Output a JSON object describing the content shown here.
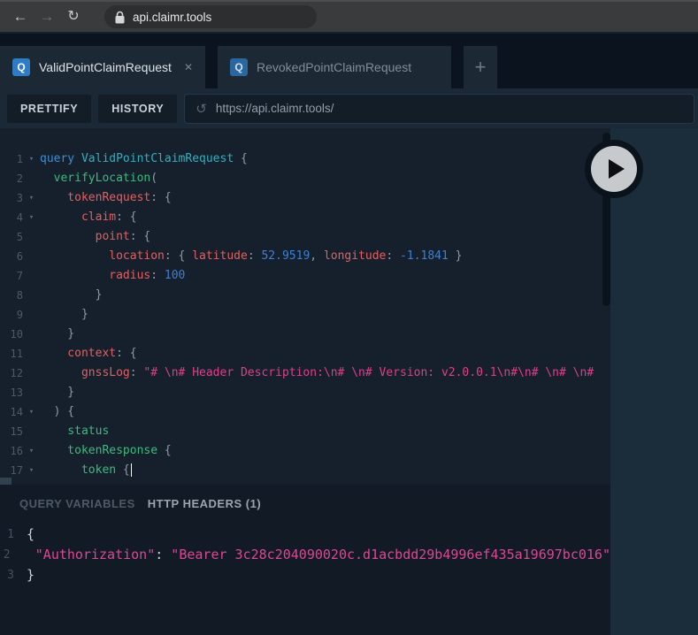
{
  "browser": {
    "back_icon": "←",
    "forward_icon": "→",
    "reload_icon": "↻",
    "url": "api.claimr.tools"
  },
  "tabs": [
    {
      "badge": "Q",
      "label": "ValidPointClaimRequest",
      "close_icon": "✕",
      "active": true
    },
    {
      "badge": "Q",
      "label": "RevokedPointClaimRequest",
      "active": false
    }
  ],
  "new_tab_label": "+",
  "toolbar": {
    "prettify_label": "PRETTIFY",
    "history_label": "HISTORY",
    "reload_icon": "↺",
    "endpoint_url": "https://api.claimr.tools/"
  },
  "editor": {
    "lines": [
      {
        "n": 1,
        "f": true,
        "t": [
          [
            "kw",
            "query"
          ],
          [
            "op",
            " ValidPointClaimRequest"
          ],
          [
            "pun",
            " {"
          ]
        ]
      },
      {
        "n": 2,
        "f": false,
        "t": [
          [
            "fld",
            "  verifyLocation"
          ],
          [
            "pun",
            "("
          ]
        ]
      },
      {
        "n": 3,
        "f": true,
        "t": [
          [
            "arg",
            "    tokenRequest"
          ],
          [
            "pun",
            ": {"
          ]
        ]
      },
      {
        "n": 4,
        "f": true,
        "t": [
          [
            "arg",
            "      claim"
          ],
          [
            "pun",
            ": {"
          ]
        ]
      },
      {
        "n": 5,
        "f": false,
        "t": [
          [
            "arg",
            "        point"
          ],
          [
            "pun",
            ": {"
          ]
        ]
      },
      {
        "n": 6,
        "f": false,
        "t": [
          [
            "arg",
            "          location"
          ],
          [
            "pun",
            ": { "
          ],
          [
            "arg",
            "latitude"
          ],
          [
            "pun",
            ": "
          ],
          [
            "num",
            "52.9519"
          ],
          [
            "pun",
            ", "
          ],
          [
            "arg",
            "longitude"
          ],
          [
            "pun",
            ": "
          ],
          [
            "num",
            "-1.1841"
          ],
          [
            "pun",
            " }"
          ]
        ]
      },
      {
        "n": 7,
        "f": false,
        "t": [
          [
            "arg",
            "          radius"
          ],
          [
            "pun",
            ": "
          ],
          [
            "num",
            "100"
          ]
        ]
      },
      {
        "n": 8,
        "f": false,
        "t": [
          [
            "pun",
            "        }"
          ]
        ]
      },
      {
        "n": 9,
        "f": false,
        "t": [
          [
            "pun",
            "      }"
          ]
        ]
      },
      {
        "n": 10,
        "f": false,
        "t": [
          [
            "pun",
            "    }"
          ]
        ]
      },
      {
        "n": 11,
        "f": false,
        "t": [
          [
            "arg",
            "    context"
          ],
          [
            "pun",
            ": {"
          ]
        ]
      },
      {
        "n": 12,
        "f": false,
        "t": [
          [
            "arg",
            "      gnssLog"
          ],
          [
            "pun",
            ": "
          ],
          [
            "str",
            "\"# \\n# Header Description:\\n# \\n# Version: v2.0.0.1\\n#\\n# \\n# \\n#"
          ]
        ]
      },
      {
        "n": 13,
        "f": false,
        "t": [
          [
            "pun",
            "    }"
          ]
        ]
      },
      {
        "n": 14,
        "f": true,
        "t": [
          [
            "pun",
            "  ) {"
          ]
        ]
      },
      {
        "n": 15,
        "f": false,
        "t": [
          [
            "fld",
            "    status"
          ]
        ]
      },
      {
        "n": 16,
        "f": true,
        "t": [
          [
            "fld",
            "    tokenResponse"
          ],
          [
            "pun",
            " {"
          ]
        ]
      },
      {
        "n": 17,
        "f": true,
        "t": [
          [
            "fld",
            "      token"
          ],
          [
            "pun",
            " {"
          ]
        ],
        "cursor": true
      }
    ]
  },
  "bottom": {
    "tabs": [
      {
        "label": "QUERY VARIABLES",
        "active": false
      },
      {
        "label": "HTTP HEADERS (1)",
        "active": true
      }
    ],
    "lines": [
      {
        "n": 1,
        "f": false,
        "t": [
          [
            "hpun",
            "{"
          ]
        ]
      },
      {
        "n": 2,
        "f": false,
        "t": [
          [
            "hstr",
            "  \"Authorization\""
          ],
          [
            "hpun",
            ": "
          ],
          [
            "hstr",
            "\"Bearer 3c28c204090020c.d1acbdd29b4996ef435a19697bc016\""
          ]
        ]
      },
      {
        "n": 3,
        "f": false,
        "t": [
          [
            "hpun",
            "}"
          ]
        ]
      }
    ]
  },
  "colors": {
    "accent_tab_badge": "#2d7cc4",
    "syntax": {
      "kw": "#3e8fd6",
      "op": "#2fb1be",
      "fld": "#3cbb7c",
      "arg": "#e45f5f",
      "num": "#3b81d6",
      "str": "#e03e8c",
      "pun": "#8e9aa6",
      "hstr": "#dc4795",
      "hpun": "#c9d1d9"
    }
  }
}
